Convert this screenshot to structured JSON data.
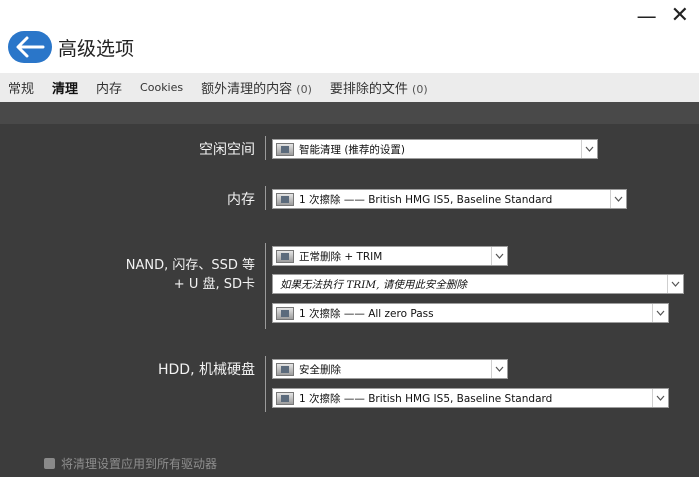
{
  "window": {
    "minimize_label": "—",
    "close_label": "✕"
  },
  "header": {
    "back_icon": "arrow-left-icon",
    "title": "高级选项"
  },
  "tabs": [
    {
      "label": "常规"
    },
    {
      "label": "清理"
    },
    {
      "label": "内存"
    },
    {
      "label": "Cookies"
    },
    {
      "label": "额外清理的内容",
      "count": "(0)"
    },
    {
      "label": "要排除的文件",
      "count": "(0)"
    }
  ],
  "free_space": {
    "label": "空闲空间",
    "dropdown": "智能清理 (推荐的设置)"
  },
  "memory": {
    "label": "内存",
    "dropdown": "1 次擦除  ——  British HMG IS5, Baseline Standard"
  },
  "nand": {
    "label_line1": "NAND, 闪存、SSD 等",
    "label_line2": "+ U 盘, SD卡",
    "dropdown1": "正常删除 + TRIM",
    "dropdown2": "如果无法执行 TRIM, 请使用此安全删除",
    "dropdown3": "1 次擦除  ——  All zero Pass"
  },
  "hdd": {
    "label": "HDD, 机械硬盘",
    "dropdown1": "安全删除",
    "dropdown2": "1 次擦除  ——  British HMG IS5, Baseline Standard"
  },
  "footer": {
    "checkbox_label": "将清理设置应用到所有驱动器",
    "checked": true
  },
  "colors": {
    "accent": "#2a76c9",
    "panel_bg": "#3c3c3c",
    "tab_bar_bg": "#ececec"
  }
}
